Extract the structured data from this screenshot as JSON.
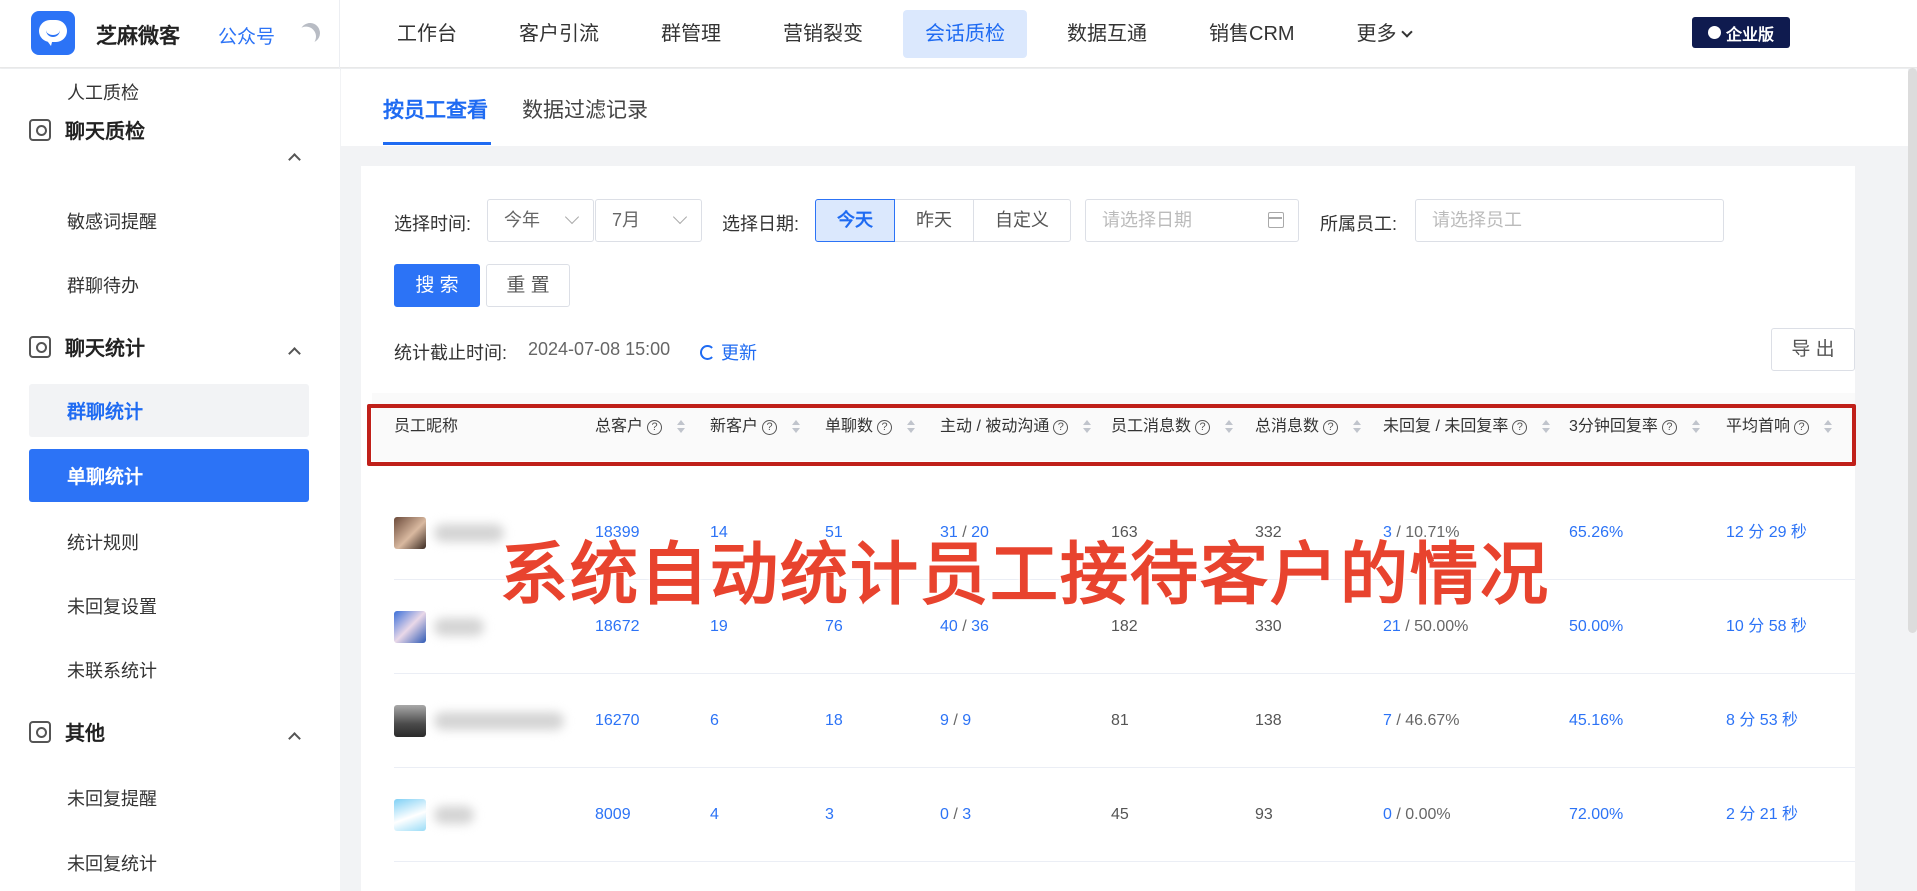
{
  "app": {
    "name": "芝麻微客",
    "account_link": "公众号",
    "edition": "企业版"
  },
  "nav": [
    {
      "label": "工作台",
      "active": false
    },
    {
      "label": "客户引流",
      "active": false
    },
    {
      "label": "群管理",
      "active": false
    },
    {
      "label": "营销裂变",
      "active": false
    },
    {
      "label": "会话质检",
      "active": true
    },
    {
      "label": "数据互通",
      "active": false
    },
    {
      "label": "销售CRM",
      "active": false
    },
    {
      "label": "更多",
      "active": false
    }
  ],
  "sidebar": {
    "top_item": "人工质检",
    "groups": [
      {
        "title": "聊天质检",
        "items": [
          "敏感词提醒",
          "群聊待办"
        ]
      },
      {
        "title": "聊天统计",
        "items": [
          "群聊统计",
          "单聊统计",
          "统计规则",
          "未回复设置",
          "未联系统计"
        ]
      },
      {
        "title": "其他",
        "items": [
          "未回复提醒",
          "未回复统计"
        ]
      }
    ]
  },
  "tabs": [
    "按员工查看",
    "数据过滤记录"
  ],
  "filters": {
    "time_label": "选择时间:",
    "year": "今年",
    "month": "7月",
    "date_label": "选择日期:",
    "date_options": [
      "今天",
      "昨天",
      "自定义"
    ],
    "date_placeholder": "请选择日期",
    "staff_label": "所属员工:",
    "staff_placeholder": "请选择员工",
    "search_btn": "搜 索",
    "reset_btn": "重 置"
  },
  "stat": {
    "label": "统计截止时间:",
    "time": "2024-07-08 15:00",
    "refresh": "更新",
    "export": "导 出"
  },
  "columns": [
    "员工昵称",
    "总客户",
    "新客户",
    "单聊数",
    "主动 / 被动沟通",
    "员工消息数",
    "总消息数",
    "未回复 / 未回复率",
    "3分钟回复率",
    "平均首响"
  ],
  "rows": [
    {
      "total": "18399",
      "new": "14",
      "chats": "51",
      "active": "31",
      "passive": "20",
      "staff_msgs": "163",
      "total_msgs": "332",
      "no_reply": "3",
      "no_reply_rate": "/ 10.71%",
      "rate3": "65.26%",
      "avg": "12 分 29 秒"
    },
    {
      "total": "18672",
      "new": "19",
      "chats": "76",
      "active": "40",
      "passive": "36",
      "staff_msgs": "182",
      "total_msgs": "330",
      "no_reply": "21",
      "no_reply_rate": "/ 50.00%",
      "rate3": "50.00%",
      "avg": "10 分 58 秒"
    },
    {
      "total": "16270",
      "new": "6",
      "chats": "18",
      "active": "9",
      "passive": "9",
      "staff_msgs": "81",
      "total_msgs": "138",
      "no_reply": "7",
      "no_reply_rate": "/ 46.67%",
      "rate3": "45.16%",
      "avg": "8 分 53 秒"
    },
    {
      "total": "8009",
      "new": "4",
      "chats": "3",
      "active": "0",
      "passive": "3",
      "staff_msgs": "45",
      "total_msgs": "93",
      "no_reply": "0",
      "no_reply_rate": "/ 0.00%",
      "rate3": "72.00%",
      "avg": "2 分 21 秒"
    }
  ],
  "overlay_caption": "系统自动统计员工接待客户的情况",
  "colors": {
    "accent": "#2c73f6",
    "annotation_red": "#e8432e",
    "box_red": "#c0201a",
    "badge": "#0f1b4f"
  }
}
